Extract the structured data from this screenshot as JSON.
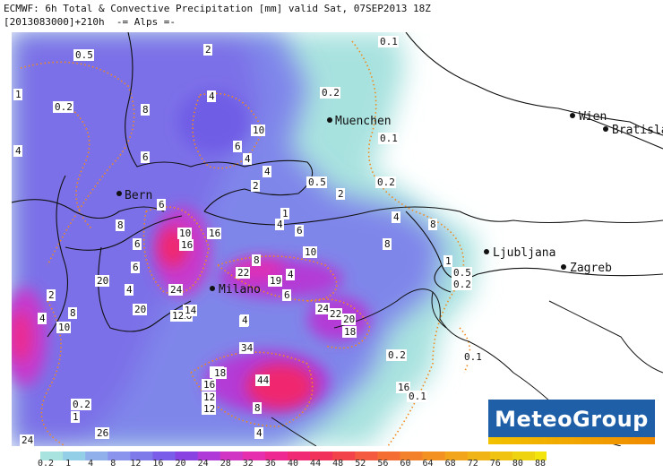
{
  "header": {
    "line1": "ECMWF: 6h Total & Convective Precipitation [mm] valid Sat, 07SEP2013 18Z",
    "line2": "[2013083000]+210h  -= Alps =-"
  },
  "cities": [
    {
      "name": "Muenchen"
    },
    {
      "name": "Wien"
    },
    {
      "name": "Bratislav"
    },
    {
      "name": "Bern"
    },
    {
      "name": "Ljubljana"
    },
    {
      "name": "Zagreb"
    },
    {
      "name": "Milano"
    }
  ],
  "contour_labels": [
    "0.5",
    "2",
    "0.1",
    "0.2",
    "0.1",
    "0.2",
    "1",
    "4",
    "8",
    "6",
    "10",
    "4",
    "4",
    "6",
    "0.5",
    "2",
    "0.2",
    "2",
    "4",
    "4",
    "8",
    "16",
    "10",
    "6",
    "16",
    "1",
    "4",
    "6",
    "6",
    "10",
    "8",
    "8",
    "4",
    "6",
    "20",
    "24",
    "22",
    "19",
    "4",
    "6",
    "20",
    "8",
    "16",
    "1",
    "0.5",
    "0.2",
    "2",
    "4",
    "18",
    "12",
    "14",
    "4",
    "24",
    "22",
    "20",
    "18",
    "4",
    "10",
    "8",
    "34",
    "0.2",
    "0.1",
    "18",
    "44",
    "16",
    "12",
    "12",
    "16",
    "0.1",
    "0.2",
    "8",
    "26",
    "4",
    "24",
    "1",
    "6"
  ],
  "colorbar": {
    "ticks": [
      "0.2",
      "1",
      "4",
      "8",
      "12",
      "16",
      "20",
      "24",
      "28",
      "32",
      "36",
      "40",
      "44",
      "48",
      "52",
      "56",
      "60",
      "64",
      "68",
      "72",
      "76",
      "80",
      "88"
    ],
    "colors": [
      "#a9e3e0",
      "#93cfe7",
      "#8fb0ea",
      "#8a94ec",
      "#7e7aea",
      "#7a5de8",
      "#8a43e3",
      "#b03ad7",
      "#d135c4",
      "#e52fae",
      "#ee2a92",
      "#f02a74",
      "#f2315a",
      "#f3434a",
      "#f45a40",
      "#f46e34",
      "#f3812b",
      "#f39222",
      "#f2a41b",
      "#f1b416",
      "#f0c312",
      "#eed310",
      "#f2e40c"
    ]
  },
  "logo": {
    "text": "MeteoGroup"
  }
}
